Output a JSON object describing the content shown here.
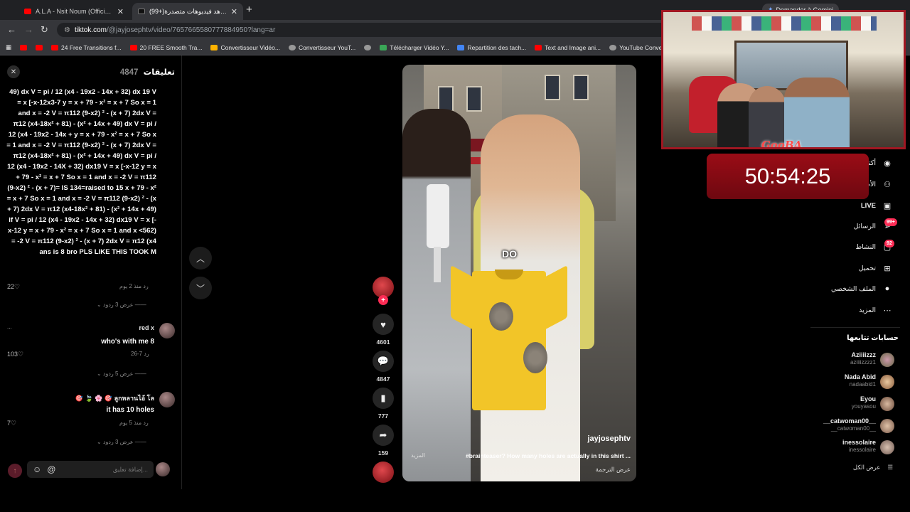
{
  "browser": {
    "tabs": [
      {
        "title": "A.L.A - Nsit Noum (Official Mus...",
        "active": false
      },
      {
        "title": "(99+)شاهد فيديوهات متصدرة | ...",
        "active": true
      }
    ],
    "gemini_label": "Demander à Gemini",
    "url_domain": "tiktok.com",
    "url_path": "/@jayjosephtv/video/7657665580777884950?lang=ar",
    "bookmarks": [
      {
        "label": "",
        "icon": "youtube-icon"
      },
      {
        "label": "",
        "icon": "youtube-icon"
      },
      {
        "label": "24 Free Transitions f...",
        "icon": "youtube-icon"
      },
      {
        "label": "20 FREE Smooth Tra...",
        "icon": "youtube-icon"
      },
      {
        "label": "Convertisseur Vidéo...",
        "icon": "z-icon"
      },
      {
        "label": "Convertisseur YouT...",
        "icon": "convert-icon"
      },
      {
        "label": "",
        "icon": "globe-icon"
      },
      {
        "label": "Télécharger Vidéo Y...",
        "icon": "download-icon"
      },
      {
        "label": "Repartition des tach...",
        "icon": "docs-icon"
      },
      {
        "label": "Text and Image ani...",
        "icon": "youtube-icon"
      },
      {
        "label": "YouTube Converter...",
        "icon": "globe-icon"
      }
    ]
  },
  "comments": {
    "title": "تعليقات",
    "count": "4847",
    "long_comment": "49) dx V = pi / 12 (x4 - 19x2 - 14x + 32) dx 19 V = x [-x-12x3-7 y = x + 79 - x² = x + 7 So x = 1 and x = -2 V = π112 (9-x2) ² - (x + 7) 2dx V = π12 (x4-18x² + 81) - (x² + 14x + 49) dx V = pi / 12 (x4 - 19x2 - 14x + y = x + 79 - x² = x + 7 So x = 1 and x = -2 V = π112 (9-x2) ² - (x + 7) 2dx V = π12 (x4-18x² + 81) - (x² + 14x + 49) dx V = pi / 12 (x4 - 19x2 - 14X + 32) dx19 V = x [-x-12 y = x + 79 - x² = x + 7 So x = 1 and x = -2 V = π112 (9-x2) ² - (x + 7)= IS 134=raised to 15 x + 79 - x² = x + 7 So x = 1 and x = -2 V = π112 (9-x2) ² - (x + 7) 2dx V = π12 (x4-18x² + 81) - (x² + 14x + 49) if V = pi / 12 (x4 - 19x2 - 14x + 32) dx19 V = x [-x-12 y = x + 79 - x² = x + 7 So x = 1 and x <562) = -2 V = π112 (9-x2) ² - (x + 7) 2dx V = π12 (x4 ans is 8 bro PLS LIKE THIS TOOK M",
    "items": [
      {
        "likes": "22",
        "time": "منذ 2 يوم",
        "reply": "رد",
        "view_replies": "عرض 3 ردود"
      },
      {
        "username": "red x",
        "text": "who's with me 8",
        "likes": "103",
        "time": "7-26",
        "reply": "رد",
        "view_replies": "عرض 5 ردود"
      },
      {
        "username": "ลูกหลานไอ้ โล",
        "emoji": "🎯 🍃 🌸 🎯",
        "text": "it has 10 holes",
        "likes": "7",
        "time": "منذ 5 يوم",
        "reply": "رد",
        "view_replies": "عرض 3 ردود"
      }
    ],
    "more": "...",
    "input_placeholder": "إضافة تعليق..."
  },
  "video": {
    "overlay_caption": "DO",
    "author": "jayjosephtv",
    "description": "#brainteaser? How many holes are actually in this shirt ...",
    "more": "المزيد",
    "translate": "عرض الترجمة",
    "shirt_holes_visible": 2
  },
  "actions": {
    "likes": "4601",
    "comments": "4847",
    "saves": "777",
    "shares": "159"
  },
  "sidebar": {
    "nav": [
      {
        "label": "أكتشف",
        "icon": "avatar-icon"
      },
      {
        "label": "الأصدقاء",
        "icon": "users-icon"
      },
      {
        "label": "LIVE",
        "icon": "live-icon"
      },
      {
        "label": "الرسائل",
        "icon": "messages-icon",
        "badge": "99+"
      },
      {
        "label": "النشاط",
        "icon": "activity-icon",
        "badge": "92"
      },
      {
        "label": "تحميل",
        "icon": "upload-icon"
      },
      {
        "label": "الملف الشخصي",
        "icon": "profile-icon"
      },
      {
        "label": "المزيد",
        "icon": "more-icon"
      }
    ],
    "following_title": "حسابات تتابعها",
    "following": [
      {
        "name": "Aziiiizzz",
        "handle": "aziiiizzzz1"
      },
      {
        "name": "Nada Abid",
        "handle": "nadaabid1"
      },
      {
        "name": "Eyou",
        "handle": "youyasou"
      },
      {
        "name": "__catwoman00__",
        "handle": "__catwoman00__"
      },
      {
        "name": "inessolaire",
        "handle": "inessolaire"
      }
    ],
    "see_all": "عرض الكل"
  },
  "overlay": {
    "logo_text": "GooBA",
    "timer": "50:54:25"
  },
  "colors": {
    "accent": "#fe2c55",
    "timer_bg": "#9a0c16",
    "shirt": "#f2c528"
  }
}
